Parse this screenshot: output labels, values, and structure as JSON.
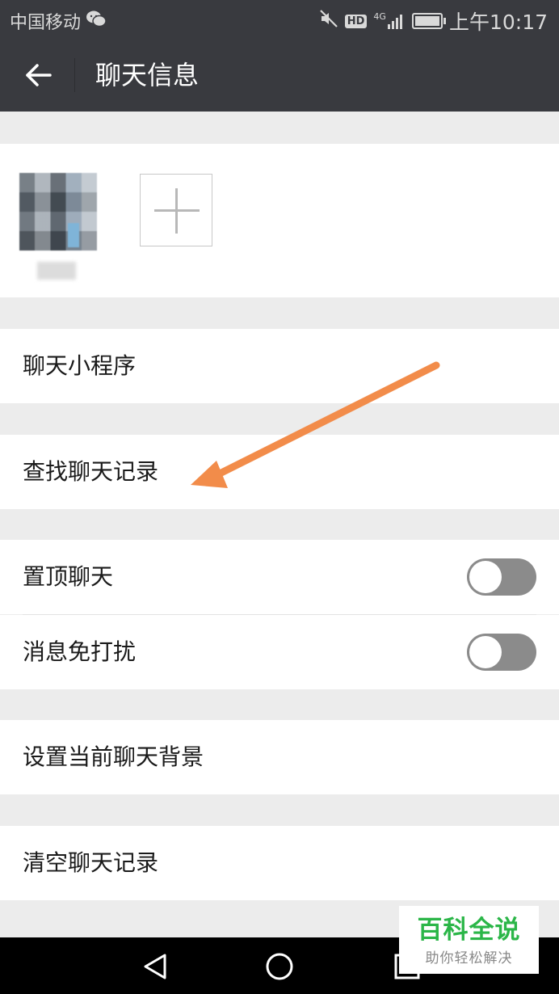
{
  "status_bar": {
    "carrier": "中国移动",
    "hd": "HD",
    "network": "4G",
    "time": "上午10:17"
  },
  "header": {
    "title": "聊天信息"
  },
  "menu": {
    "mini_programs": "聊天小程序",
    "search_history": "查找聊天记录",
    "pin_chat": "置顶聊天",
    "mute_notifications": "消息免打扰",
    "set_background": "设置当前聊天背景",
    "clear_history": "清空聊天记录"
  },
  "toggles": {
    "pin_chat_on": false,
    "mute_notifications_on": false
  },
  "watermark": {
    "main": "百科全说",
    "sub": "助你轻松解决"
  },
  "colors": {
    "header_bg": "#393a3f",
    "page_bg": "#ececec",
    "arrow": "#f28c4a",
    "toggle_off": "#8b8b8b",
    "watermark_green": "#2bb648"
  },
  "icons": [
    "back-arrow-icon",
    "wechat-icon",
    "mute-icon",
    "signal-icon",
    "battery-icon",
    "plus-icon",
    "nav-back-icon",
    "nav-home-icon",
    "nav-recents-icon"
  ]
}
